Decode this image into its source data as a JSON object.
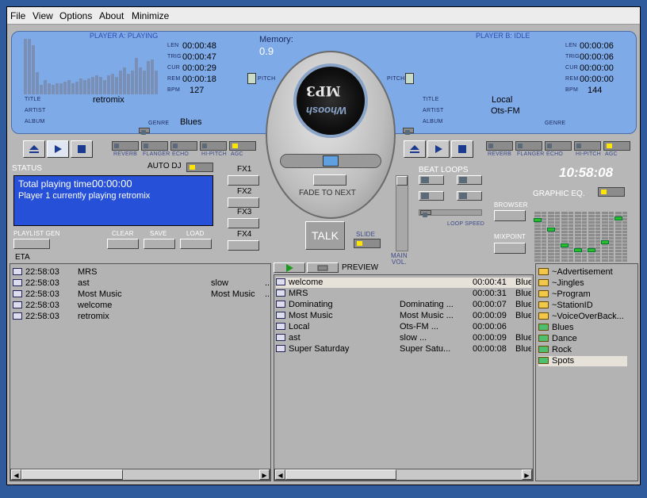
{
  "menu": [
    "File",
    "View",
    "Options",
    "About",
    "Minimize"
  ],
  "playerA": {
    "header": "PLAYER A: PLAYING",
    "len_label": "LEN",
    "len": "00:00:48",
    "trig_label": "TRIG",
    "trig": "00:00:47",
    "cur_label": "CUR",
    "cur": "00:00:29",
    "rem_label": "REM",
    "rem": "00:00:18",
    "bpm_label": "BPM",
    "bpm": "127",
    "title_label": "TITLE",
    "title": "retromix",
    "artist_label": "ARTIST",
    "artist": "",
    "album_label": "ALBUM",
    "album": "",
    "genre_label": "GENRE",
    "genre": "Blues",
    "pitch_label": "PITCH"
  },
  "playerB": {
    "header": "PLAYER B: IDLE",
    "len_label": "LEN",
    "len": "00:00:06",
    "trig_label": "TRIG",
    "trig": "00:00:06",
    "cur_label": "CUR",
    "cur": "00:00:00",
    "rem_label": "REM",
    "rem": "00:00:00",
    "bpm_label": "BPM",
    "bpm": "144",
    "title_label": "TITLE",
    "title": "Local",
    "artist_label": "ARTIST",
    "artist": "Ots-FM",
    "album_label": "ALBUM",
    "album": "",
    "genre_label": "GENRE",
    "genre": "",
    "pitch_label": "PITCH"
  },
  "memory": {
    "label": "Memory:",
    "value": "0.9"
  },
  "logo": {
    "line1": "MP3",
    "line2": "Whoosh"
  },
  "effects": [
    "REVERB",
    "FLANGER",
    "ECHO",
    "HI-PITCH",
    "AGC"
  ],
  "center": {
    "fade_label": "FADE TO NEXT",
    "talk": "TALK",
    "slide": "SLIDE",
    "main_vol": "MAIN\nVOL."
  },
  "fx_buttons": [
    "FX1",
    "FX2",
    "FX3",
    "FX4"
  ],
  "status": {
    "label": "STATUS",
    "autodj": "AUTO DJ",
    "total_label": "Total playing time:",
    "total": "00:00:00",
    "message": "Player 1 currently playing retromix"
  },
  "playlist_controls": {
    "gen": "PLAYLIST GEN",
    "clear": "CLEAR",
    "save": "SAVE",
    "load": "LOAD",
    "eta": "ETA"
  },
  "beat_loops": {
    "label": "BEAT LOOPS",
    "speed": "LOOP SPEED"
  },
  "clock": "10:58:08",
  "right_controls": {
    "browser": "BROWSER",
    "mixpoint": "MIXPOINT",
    "eq": "GRAPHIC EQ."
  },
  "queue": [
    {
      "time": "22:58:03",
      "title": "MRS",
      "artist": "",
      "more": ""
    },
    {
      "time": "22:58:03",
      "title": "ast",
      "artist": "slow",
      "more": ".."
    },
    {
      "time": "22:58:03",
      "title": "Most Music",
      "artist": "Most Music",
      "more": ".."
    },
    {
      "time": "22:58:03",
      "title": "welcome",
      "artist": "",
      "more": ""
    },
    {
      "time": "22:58:03",
      "title": "retromix",
      "artist": "",
      "more": ""
    }
  ],
  "preview_label": "PREVIEW",
  "library": [
    {
      "title": "welcome",
      "artist": "",
      "len": "00:00:41",
      "genre": "Blue"
    },
    {
      "title": "MRS",
      "artist": "",
      "len": "00:00:31",
      "genre": "Blue"
    },
    {
      "title": "Dominating",
      "artist": "Dominating ...",
      "len": "00:00:07",
      "genre": "Blue"
    },
    {
      "title": "Most Music",
      "artist": "Most Music ...",
      "len": "00:00:09",
      "genre": "Blue"
    },
    {
      "title": "Local",
      "artist": "Ots-FM    ...",
      "len": "00:00:06",
      "genre": ""
    },
    {
      "title": "ast",
      "artist": "slow       ...",
      "len": "00:00:09",
      "genre": "Blue"
    },
    {
      "title": "Super Saturday",
      "artist": "Super Satu...",
      "len": "00:00:08",
      "genre": "Blue"
    }
  ],
  "categories": [
    {
      "name": "~Advertisement",
      "type": "folder"
    },
    {
      "name": "~Jingles",
      "type": "folder"
    },
    {
      "name": "~Program",
      "type": "folder"
    },
    {
      "name": "~StationID",
      "type": "folder"
    },
    {
      "name": "~VoiceOverBack...",
      "type": "folder"
    },
    {
      "name": "Blues",
      "type": "genre"
    },
    {
      "name": "Dance",
      "type": "genre"
    },
    {
      "name": "Rock",
      "type": "genre"
    },
    {
      "name": "Spots",
      "type": "genre",
      "selected": true
    }
  ],
  "colors": {
    "desktop": "#2f5b9d",
    "display": "#7faae8",
    "status": "#2650d8",
    "led": "#ffe600"
  }
}
